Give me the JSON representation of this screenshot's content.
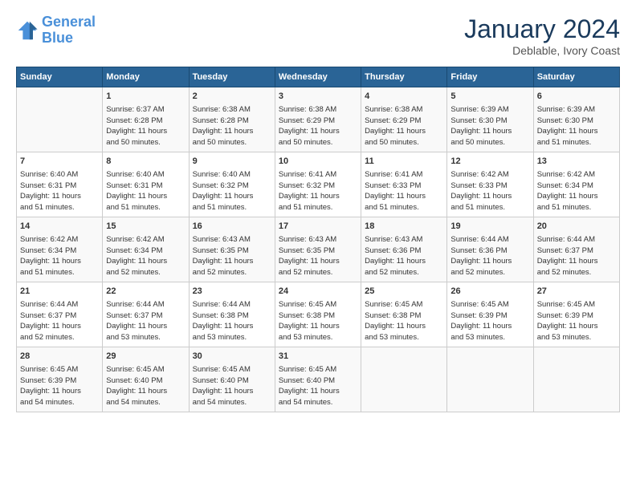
{
  "logo": {
    "line1": "General",
    "line2": "Blue"
  },
  "title": "January 2024",
  "subtitle": "Deblable, Ivory Coast",
  "headers": [
    "Sunday",
    "Monday",
    "Tuesday",
    "Wednesday",
    "Thursday",
    "Friday",
    "Saturday"
  ],
  "weeks": [
    [
      {
        "day": "",
        "content": ""
      },
      {
        "day": "1",
        "content": "Sunrise: 6:37 AM\nSunset: 6:28 PM\nDaylight: 11 hours\nand 50 minutes."
      },
      {
        "day": "2",
        "content": "Sunrise: 6:38 AM\nSunset: 6:28 PM\nDaylight: 11 hours\nand 50 minutes."
      },
      {
        "day": "3",
        "content": "Sunrise: 6:38 AM\nSunset: 6:29 PM\nDaylight: 11 hours\nand 50 minutes."
      },
      {
        "day": "4",
        "content": "Sunrise: 6:38 AM\nSunset: 6:29 PM\nDaylight: 11 hours\nand 50 minutes."
      },
      {
        "day": "5",
        "content": "Sunrise: 6:39 AM\nSunset: 6:30 PM\nDaylight: 11 hours\nand 50 minutes."
      },
      {
        "day": "6",
        "content": "Sunrise: 6:39 AM\nSunset: 6:30 PM\nDaylight: 11 hours\nand 51 minutes."
      }
    ],
    [
      {
        "day": "7",
        "content": "Sunrise: 6:40 AM\nSunset: 6:31 PM\nDaylight: 11 hours\nand 51 minutes."
      },
      {
        "day": "8",
        "content": "Sunrise: 6:40 AM\nSunset: 6:31 PM\nDaylight: 11 hours\nand 51 minutes."
      },
      {
        "day": "9",
        "content": "Sunrise: 6:40 AM\nSunset: 6:32 PM\nDaylight: 11 hours\nand 51 minutes."
      },
      {
        "day": "10",
        "content": "Sunrise: 6:41 AM\nSunset: 6:32 PM\nDaylight: 11 hours\nand 51 minutes."
      },
      {
        "day": "11",
        "content": "Sunrise: 6:41 AM\nSunset: 6:33 PM\nDaylight: 11 hours\nand 51 minutes."
      },
      {
        "day": "12",
        "content": "Sunrise: 6:42 AM\nSunset: 6:33 PM\nDaylight: 11 hours\nand 51 minutes."
      },
      {
        "day": "13",
        "content": "Sunrise: 6:42 AM\nSunset: 6:34 PM\nDaylight: 11 hours\nand 51 minutes."
      }
    ],
    [
      {
        "day": "14",
        "content": "Sunrise: 6:42 AM\nSunset: 6:34 PM\nDaylight: 11 hours\nand 51 minutes."
      },
      {
        "day": "15",
        "content": "Sunrise: 6:42 AM\nSunset: 6:34 PM\nDaylight: 11 hours\nand 52 minutes."
      },
      {
        "day": "16",
        "content": "Sunrise: 6:43 AM\nSunset: 6:35 PM\nDaylight: 11 hours\nand 52 minutes."
      },
      {
        "day": "17",
        "content": "Sunrise: 6:43 AM\nSunset: 6:35 PM\nDaylight: 11 hours\nand 52 minutes."
      },
      {
        "day": "18",
        "content": "Sunrise: 6:43 AM\nSunset: 6:36 PM\nDaylight: 11 hours\nand 52 minutes."
      },
      {
        "day": "19",
        "content": "Sunrise: 6:44 AM\nSunset: 6:36 PM\nDaylight: 11 hours\nand 52 minutes."
      },
      {
        "day": "20",
        "content": "Sunrise: 6:44 AM\nSunset: 6:37 PM\nDaylight: 11 hours\nand 52 minutes."
      }
    ],
    [
      {
        "day": "21",
        "content": "Sunrise: 6:44 AM\nSunset: 6:37 PM\nDaylight: 11 hours\nand 52 minutes."
      },
      {
        "day": "22",
        "content": "Sunrise: 6:44 AM\nSunset: 6:37 PM\nDaylight: 11 hours\nand 53 minutes."
      },
      {
        "day": "23",
        "content": "Sunrise: 6:44 AM\nSunset: 6:38 PM\nDaylight: 11 hours\nand 53 minutes."
      },
      {
        "day": "24",
        "content": "Sunrise: 6:45 AM\nSunset: 6:38 PM\nDaylight: 11 hours\nand 53 minutes."
      },
      {
        "day": "25",
        "content": "Sunrise: 6:45 AM\nSunset: 6:38 PM\nDaylight: 11 hours\nand 53 minutes."
      },
      {
        "day": "26",
        "content": "Sunrise: 6:45 AM\nSunset: 6:39 PM\nDaylight: 11 hours\nand 53 minutes."
      },
      {
        "day": "27",
        "content": "Sunrise: 6:45 AM\nSunset: 6:39 PM\nDaylight: 11 hours\nand 53 minutes."
      }
    ],
    [
      {
        "day": "28",
        "content": "Sunrise: 6:45 AM\nSunset: 6:39 PM\nDaylight: 11 hours\nand 54 minutes."
      },
      {
        "day": "29",
        "content": "Sunrise: 6:45 AM\nSunset: 6:40 PM\nDaylight: 11 hours\nand 54 minutes."
      },
      {
        "day": "30",
        "content": "Sunrise: 6:45 AM\nSunset: 6:40 PM\nDaylight: 11 hours\nand 54 minutes."
      },
      {
        "day": "31",
        "content": "Sunrise: 6:45 AM\nSunset: 6:40 PM\nDaylight: 11 hours\nand 54 minutes."
      },
      {
        "day": "",
        "content": ""
      },
      {
        "day": "",
        "content": ""
      },
      {
        "day": "",
        "content": ""
      }
    ]
  ]
}
